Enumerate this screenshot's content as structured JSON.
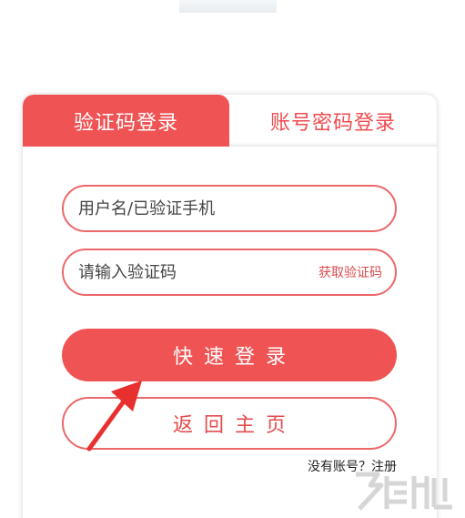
{
  "tabs": {
    "sms_login": "验证码登录",
    "password_login": "账号密码登录"
  },
  "form": {
    "username_placeholder": "用户名/已验证手机",
    "code_placeholder": "请输入验证码",
    "get_code_label": "获取验证码"
  },
  "buttons": {
    "quick_login": "快速登录",
    "back_home": "返回主页"
  },
  "links": {
    "register": "没有账号？注册"
  },
  "colors": {
    "accent": "#ef5354",
    "border": "#ec6769"
  },
  "icons": {
    "annotation": "red-arrow-icon",
    "watermark": "watermark-logo"
  }
}
